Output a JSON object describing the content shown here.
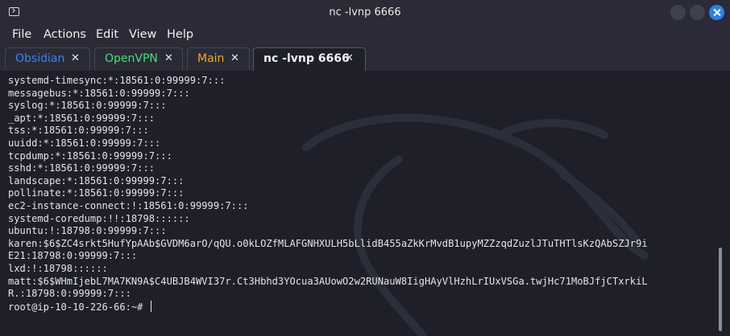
{
  "window": {
    "title": "nc -lvnp 6666"
  },
  "menu": [
    "File",
    "Actions",
    "Edit",
    "View",
    "Help"
  ],
  "tabs": [
    {
      "label": "Obsidian",
      "color": "#3b82f6",
      "close": "✕"
    },
    {
      "label": "OpenVPN",
      "color": "#4ade80",
      "close": "✕"
    },
    {
      "label": "Main",
      "color": "#f5a524",
      "close": "✕"
    },
    {
      "label": "nc -lvnp 6666",
      "color": "#f0f0f0",
      "close": "✕"
    }
  ],
  "terminal": {
    "lines": [
      "systemd-timesync:*:18561:0:99999:7:::",
      "messagebus:*:18561:0:99999:7:::",
      "syslog:*:18561:0:99999:7:::",
      "_apt:*:18561:0:99999:7:::",
      "tss:*:18561:0:99999:7:::",
      "uuidd:*:18561:0:99999:7:::",
      "tcpdump:*:18561:0:99999:7:::",
      "sshd:*:18561:0:99999:7:::",
      "landscape:*:18561:0:99999:7:::",
      "pollinate:*:18561:0:99999:7:::",
      "ec2-instance-connect:!:18561:0:99999:7:::",
      "systemd-coredump:!!:18798::::::",
      "ubuntu:!:18798:0:99999:7:::",
      "karen:$6$ZC4srkt5HufYpAAb$GVDM6arO/qQU.o0kLOZfMLAFGNHXULH5bLlidB455aZkKrMvdB1upyMZZzqdZuzlJTuTHTlsKzQAbSZJr9i",
      "E21:18798:0:99999:7:::",
      "lxd:!:18798::::::",
      "matt:$6$WHmIjebL7MA7KN9A$C4UBJB4WVI37r.Ct3Hbhd3YOcua3AUowO2w2RUNauW8IigHAyVlHzhLrIUxVSGa.twjHc71MoBJfjCTxrkiL",
      "R.:18798:0:99999:7:::"
    ],
    "prompt": "root@ip-10-10-226-66:~#"
  },
  "colors": {
    "background": "#1e1f29",
    "chrome": "#2a2b36",
    "accent": "#2f7fe6"
  }
}
